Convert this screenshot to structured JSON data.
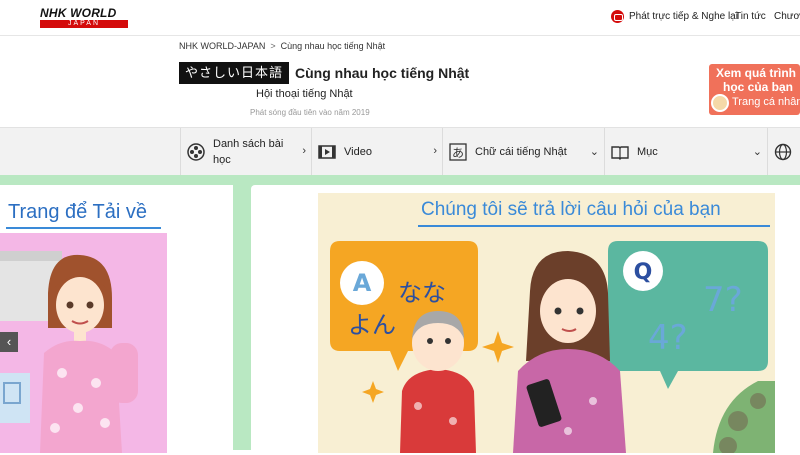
{
  "header": {
    "logo_line1": "NHK WORLD",
    "logo_line2": "JAPAN",
    "live_label": "Phát trực tiếp & Nghe lại",
    "news_label": "Tin tức",
    "more_label": "Chươ"
  },
  "breadcrumb": {
    "root": "NHK WORLD-JAPAN",
    "separator": ">",
    "current": "Cùng nhau học tiếng Nhật"
  },
  "program": {
    "jp_badge": "やさしい日本語",
    "title": "Cùng nhau học tiếng Nhật",
    "subtitle": "Hội thoại tiếng Nhật",
    "airdate": "Phát sóng đầu tiên vào năm 2019"
  },
  "promo": {
    "line1": "Xem quá trình",
    "line2": "học của bạn",
    "line3": "Trang cá nhân"
  },
  "nav": {
    "items": [
      {
        "label": "Danh sách bài học",
        "icon": "film-reel-icon",
        "arrow": "›"
      },
      {
        "label": "Video",
        "icon": "video-icon",
        "arrow": "›"
      },
      {
        "label": "Chữ cái tiếng Nhật",
        "icon": "hiragana-a-icon",
        "arrow": "⌄"
      },
      {
        "label": "Mục",
        "icon": "book-icon",
        "arrow": "⌄"
      },
      {
        "label": "",
        "icon": "globe-icon",
        "arrow": ""
      }
    ]
  },
  "banners": {
    "left_title": "Trang để Tải về",
    "right_title": "Chúng tôi sẽ trả lời câu hỏi của bạn",
    "prev_arrow": "‹"
  },
  "colors": {
    "brand_red": "#d40a0a",
    "accent_blue": "#3a8ad8",
    "promo": "#f0715a",
    "content_bg": "#b9e8c2"
  }
}
